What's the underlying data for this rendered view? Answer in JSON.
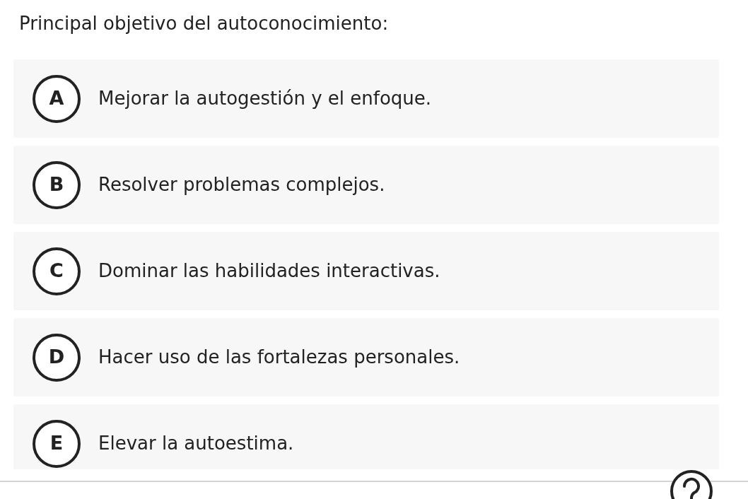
{
  "question": "Principal objetivo del autoconocimiento:",
  "options": [
    {
      "letter": "A",
      "text": "Mejorar la autogestión y el enfoque."
    },
    {
      "letter": "B",
      "text": "Resolver problemas complejos."
    },
    {
      "letter": "C",
      "text": "Dominar las habilidades interactivas."
    },
    {
      "letter": "D",
      "text": "Hacer uso de las fortalezas personales."
    },
    {
      "letter": "E",
      "text": "Elevar la autoestima."
    }
  ]
}
